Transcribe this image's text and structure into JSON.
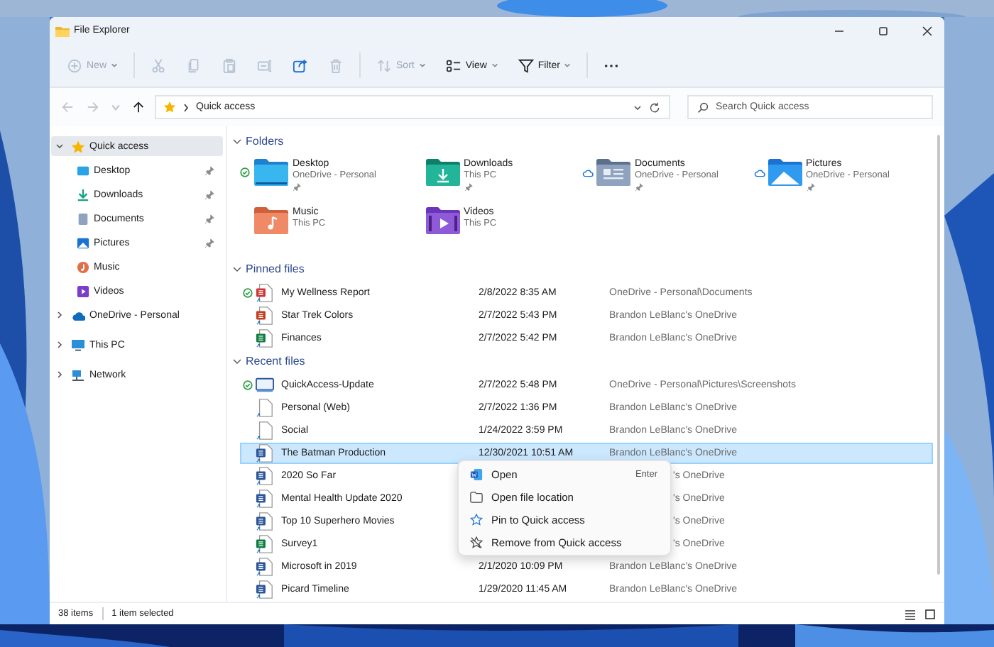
{
  "window": {
    "title": "File Explorer"
  },
  "toolbar": [
    {
      "kind": "new",
      "label": "New",
      "disabled": true,
      "dropdown": true
    },
    {
      "kind": "separator"
    },
    {
      "kind": "cut",
      "disabled": true
    },
    {
      "kind": "copy",
      "disabled": true
    },
    {
      "kind": "paste",
      "disabled": true
    },
    {
      "kind": "rename",
      "disabled": true
    },
    {
      "kind": "share",
      "disabled": false
    },
    {
      "kind": "delete",
      "disabled": true
    },
    {
      "kind": "separator"
    },
    {
      "kind": "sort",
      "label": "Sort",
      "disabled": true,
      "dropdown": true
    },
    {
      "kind": "view",
      "label": "View",
      "disabled": false,
      "dropdown": true
    },
    {
      "kind": "filter",
      "label": "Filter",
      "disabled": false,
      "dropdown": true
    },
    {
      "kind": "separator"
    },
    {
      "kind": "more",
      "disabled": false
    }
  ],
  "nav_buttons": [
    {
      "kind": "back",
      "disabled": true
    },
    {
      "kind": "forward",
      "disabled": true
    },
    {
      "kind": "recent",
      "disabled": true
    },
    {
      "kind": "up",
      "disabled": false
    }
  ],
  "address": {
    "path": "Quick access"
  },
  "search": {
    "placeholder": "Search Quick access"
  },
  "sidebar": {
    "items": [
      {
        "label": "Quick access",
        "kind": "star",
        "selected": true,
        "expanded": true,
        "children": [
          {
            "label": "Desktop",
            "kind": "desktop",
            "pinned": true,
            "selected": false
          },
          {
            "label": "Downloads",
            "kind": "downloads",
            "pinned": true,
            "selected": false
          },
          {
            "label": "Documents",
            "kind": "documents",
            "pinned": true,
            "selected": false
          },
          {
            "label": "Pictures",
            "kind": "pictures",
            "pinned": true,
            "selected": false
          },
          {
            "label": "Music",
            "kind": "music",
            "pinned": false,
            "selected": false
          },
          {
            "label": "Videos",
            "kind": "videos",
            "pinned": false,
            "selected": false
          }
        ]
      },
      {
        "label": "OneDrive - Personal",
        "kind": "cloud",
        "selected": false,
        "expanded": false
      },
      {
        "label": "This PC",
        "kind": "pc",
        "selected": false,
        "expanded": false
      },
      {
        "label": "Network",
        "kind": "network",
        "selected": false,
        "expanded": false
      }
    ]
  },
  "folders": {
    "title": "Folders",
    "expanded": true,
    "items": [
      {
        "name": "Desktop",
        "location": "OneDrive - Personal",
        "kind": "desktop",
        "synced": true,
        "online_only": false,
        "pinned": true
      },
      {
        "name": "Downloads",
        "location": "This PC",
        "kind": "downloads",
        "synced": false,
        "online_only": false,
        "pinned": true
      },
      {
        "name": "Documents",
        "location": "OneDrive - Personal",
        "kind": "documents",
        "synced": false,
        "online_only": true,
        "pinned": true
      },
      {
        "name": "Pictures",
        "location": "OneDrive - Personal",
        "kind": "pictures",
        "synced": false,
        "online_only": true,
        "pinned": true
      },
      {
        "name": "Music",
        "location": "This PC",
        "kind": "music",
        "synced": false,
        "online_only": false,
        "pinned": false
      },
      {
        "name": "Videos",
        "location": "This PC",
        "kind": "videos",
        "synced": false,
        "online_only": false,
        "pinned": false
      }
    ]
  },
  "pinned_files": {
    "title": "Pinned files",
    "expanded": true,
    "rows": [
      {
        "name": "My Wellness Report",
        "date": "2/8/2022 8:35 AM",
        "location": "OneDrive - Personal\\Documents",
        "kind": "pdf",
        "synced": true,
        "selected": false
      },
      {
        "name": "Star Trek Colors",
        "date": "2/7/2022 5:43 PM",
        "location": "Brandon LeBlanc's OneDrive",
        "kind": "ppt",
        "synced": false,
        "selected": false
      },
      {
        "name": "Finances",
        "date": "2/7/2022 5:42 PM",
        "location": "Brandon LeBlanc's OneDrive",
        "kind": "xls",
        "synced": false,
        "selected": false
      }
    ]
  },
  "recent_files": {
    "title": "Recent files",
    "expanded": true,
    "rows": [
      {
        "name": "QuickAccess-Update",
        "date": "2/7/2022 5:48 PM",
        "location": "OneDrive - Personal\\Pictures\\Screenshots",
        "kind": "screen",
        "synced": true,
        "selected": false
      },
      {
        "name": "Personal (Web)",
        "date": "2/7/2022 1:36 PM",
        "location": "Brandon LeBlanc's OneDrive",
        "kind": "blank",
        "synced": false,
        "selected": false
      },
      {
        "name": "Social",
        "date": "1/24/2022 3:59 PM",
        "location": "Brandon LeBlanc's OneDrive",
        "kind": "blank",
        "synced": false,
        "selected": false
      },
      {
        "name": "The Batman Production",
        "date": "12/30/2021 10:51 AM",
        "location": "Brandon LeBlanc's OneDrive",
        "kind": "doc",
        "synced": false,
        "selected": true
      },
      {
        "name": "2020 So Far",
        "location": "'s OneDrive",
        "kind": "doc",
        "synced": false,
        "selected": false
      },
      {
        "name": "Mental Health Update 2020",
        "location": "'s OneDrive",
        "kind": "doc",
        "synced": false,
        "selected": false
      },
      {
        "name": "Top 10 Superhero Movies",
        "location": "'s OneDrive",
        "kind": "doc",
        "synced": false,
        "selected": false
      },
      {
        "name": "Survey1",
        "location": "'s OneDrive",
        "kind": "xls",
        "synced": false,
        "selected": false
      },
      {
        "name": "Microsoft in 2019",
        "date": "2/1/2020 10:09 PM",
        "location": "Brandon LeBlanc's OneDrive",
        "kind": "doc",
        "synced": false,
        "selected": false
      },
      {
        "name": "Picard Timeline",
        "date": "1/29/2020 11:45 AM",
        "location": "Brandon LeBlanc's OneDrive",
        "kind": "doc",
        "synced": false,
        "selected": false
      }
    ]
  },
  "context_menu": {
    "items": [
      {
        "label": "Open",
        "shortcut": "Enter",
        "kind": "word"
      },
      {
        "label": "Open file location",
        "kind": "folder"
      },
      {
        "label": "Pin to Quick access",
        "kind": "pin"
      },
      {
        "label": "Remove from Quick access",
        "kind": "unpin"
      }
    ]
  },
  "status_bar": {
    "item_count": "38 items",
    "selection": "1 item selected"
  }
}
